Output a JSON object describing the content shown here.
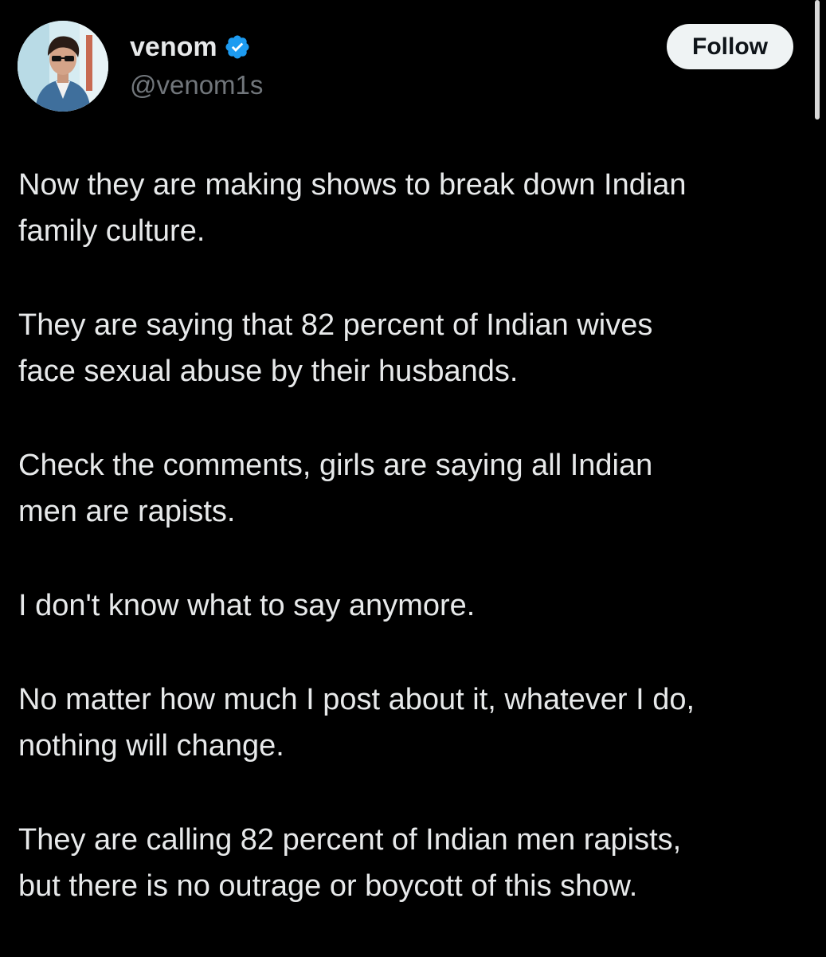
{
  "author": {
    "display_name": "venom",
    "handle": "@venom1s",
    "verified_icon": "verified-badge-icon",
    "avatar_icon": "profile-photo"
  },
  "follow_button": {
    "label": "Follow"
  },
  "tweet": {
    "paragraphs": [
      "Now they are making shows to break down Indian\nfamily culture.",
      "They are saying that 82 percent of Indian wives\nface sexual abuse by their husbands.",
      "Check the comments, girls are saying all Indian\nmen are rapists.",
      "I don't know what to say anymore.",
      "No matter how much I post about it, whatever I do,\nnothing will change.",
      "They are calling 82 percent of Indian men rapists,\nbut there is no outrage or boycott of this show."
    ]
  },
  "colors": {
    "background": "#000000",
    "text": "#e7e9ea",
    "muted": "#71767b",
    "verified": "#1d9bf0",
    "button_bg": "#eff3f4"
  }
}
